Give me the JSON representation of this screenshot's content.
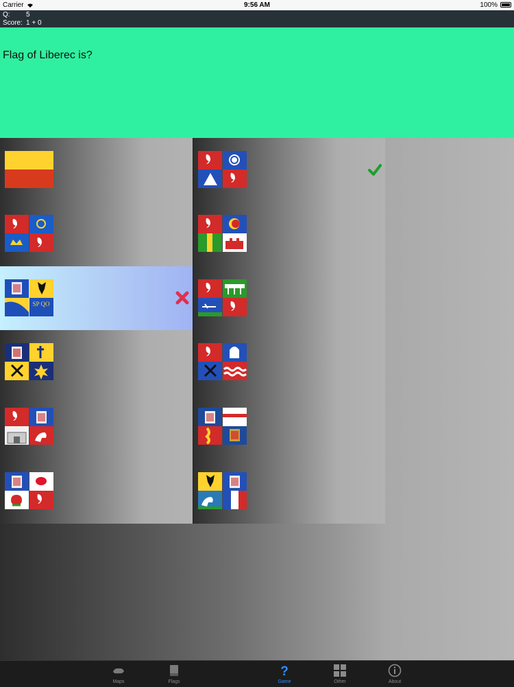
{
  "status_bar": {
    "carrier": "Carrier",
    "time": "9:56 AM",
    "battery": "100%"
  },
  "info": {
    "q_label": "Q:",
    "q_value": "5",
    "score_label": "Score:",
    "score_value": "1 + 0"
  },
  "question": {
    "text": "Flag of Liberec is?"
  },
  "options_left": [
    {
      "flag": "bicolor-yellow-red",
      "state": "none"
    },
    {
      "flag": "quartered-lion-crown",
      "state": "none"
    },
    {
      "flag": "spqo-moravian",
      "state": "wrong",
      "flag_text": "SP QO"
    },
    {
      "flag": "quartered-eagle-cross",
      "state": "none"
    },
    {
      "flag": "quartered-lion-horse",
      "state": "none"
    },
    {
      "flag": "quartered-eagle-rose",
      "state": "none"
    }
  ],
  "options_right": [
    {
      "flag": "quartered-wheel-mountain",
      "state": "correct"
    },
    {
      "flag": "quartered-rose-towers",
      "state": "none"
    },
    {
      "flag": "quartered-bridge-plough",
      "state": "none"
    },
    {
      "flag": "quartered-mitre-waves",
      "state": "none"
    },
    {
      "flag": "quartered-eagle-stripes",
      "state": "none"
    },
    {
      "flag": "quartered-eagle-horse",
      "state": "none"
    }
  ],
  "tabs": [
    {
      "label": "Maps",
      "icon": "map-icon",
      "active": false
    },
    {
      "label": "Flags",
      "icon": "flag-icon",
      "active": false
    },
    {
      "label": "",
      "icon": "blank-icon",
      "active": false
    },
    {
      "label": "Game",
      "icon": "question-icon",
      "active": true
    },
    {
      "label": "Other",
      "icon": "grid-icon",
      "active": false
    },
    {
      "label": "About",
      "icon": "info-icon",
      "active": false
    }
  ],
  "colors": {
    "question_bg": "#2ff0a0",
    "info_bg": "#263238",
    "correct_mark": "#1e9e2e",
    "wrong_mark": "#e03050",
    "active_tab": "#2d8cff"
  }
}
